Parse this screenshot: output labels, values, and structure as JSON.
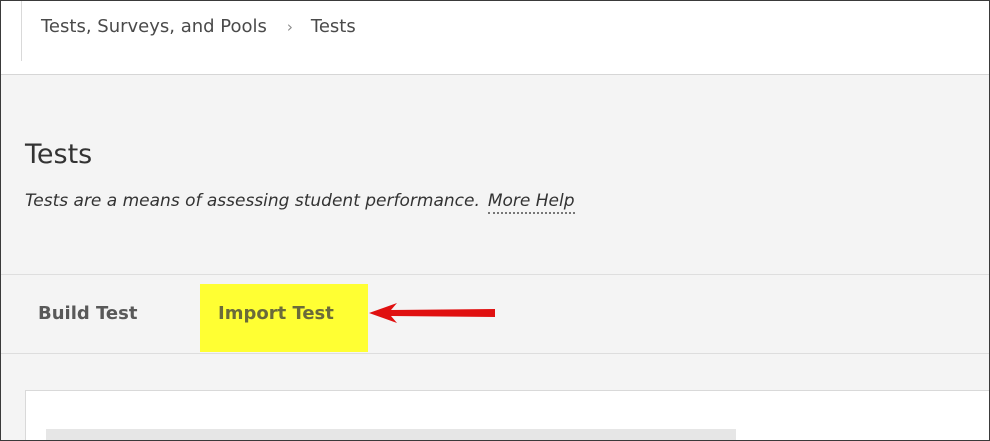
{
  "breadcrumb": {
    "items": [
      "Tests, Surveys, and Pools",
      "Tests"
    ],
    "separator": "›"
  },
  "header": {
    "title": "Tests",
    "description": "Tests are a means of assessing student performance.",
    "more_help": "More Help"
  },
  "actions": {
    "build_test": "Build Test",
    "import_test": "Import Test",
    "highlight_color": "#ffff33",
    "arrow_color": "#e01010"
  }
}
